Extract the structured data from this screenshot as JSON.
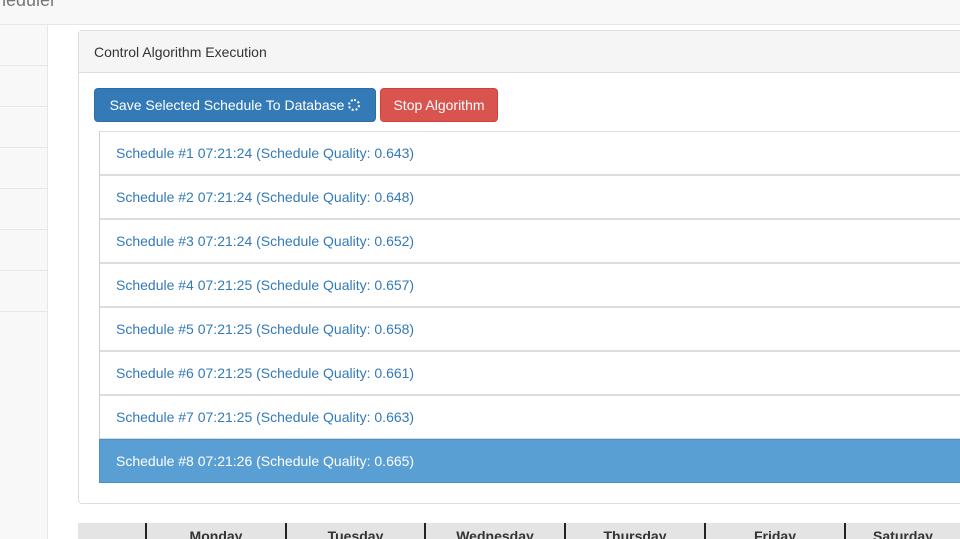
{
  "app": {
    "brand": "heduler"
  },
  "panel": {
    "heading": "Control Algorithm Execution"
  },
  "buttons": {
    "save_label": "Save Selected Schedule To Database",
    "stop_label": "Stop Algorithm"
  },
  "schedules": [
    {
      "label": "Schedule #1 07:21:24 (Schedule Quality: 0.643)",
      "active": false
    },
    {
      "label": "Schedule #2 07:21:24 (Schedule Quality: 0.648)",
      "active": false
    },
    {
      "label": "Schedule #3 07:21:24 (Schedule Quality: 0.652)",
      "active": false
    },
    {
      "label": "Schedule #4 07:21:25 (Schedule Quality: 0.657)",
      "active": false
    },
    {
      "label": "Schedule #5 07:21:25 (Schedule Quality: 0.658)",
      "active": false
    },
    {
      "label": "Schedule #6 07:21:25 (Schedule Quality: 0.661)",
      "active": false
    },
    {
      "label": "Schedule #7 07:21:25 (Schedule Quality: 0.663)",
      "active": false
    },
    {
      "label": "Schedule #8 07:21:26 (Schedule Quality: 0.665)",
      "active": true
    }
  ],
  "calendar": {
    "days": [
      "Monday",
      "Tuesday",
      "Wednesday",
      "Thursday",
      "Friday",
      "Saturday"
    ]
  },
  "colors": {
    "primary": "#337ab7",
    "danger": "#d9534f",
    "active_item": "#5a9fd4"
  }
}
